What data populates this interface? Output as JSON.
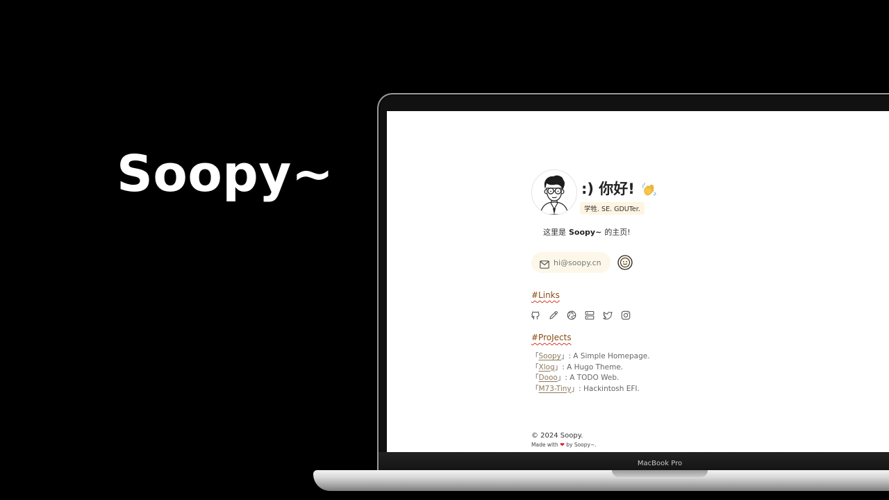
{
  "hero": {
    "title": "Soopy~"
  },
  "device": {
    "model_label": "MacBook Pro"
  },
  "profile": {
    "greeting": ":) 你好!",
    "wave_icon": "waving-hand-emoji",
    "tagline": "学牲. SE. GDUTer.",
    "intro_prefix": "这里是",
    "intro_name": "Soopy~",
    "intro_suffix": "的主页!"
  },
  "contact": {
    "email": "hi@soopy.cn",
    "mail_icon": "mail-icon",
    "extra_icon": "smile-face-icon"
  },
  "links": {
    "title": "#Links",
    "icons": [
      "github-icon",
      "pencil-icon",
      "aperture-icon",
      "server-icon",
      "twitter-icon",
      "instagram-icon"
    ]
  },
  "projects": {
    "title": "#ProJects",
    "items": [
      {
        "open": "「",
        "name": "Soopy",
        "close": "」",
        "desc": ": A Simple Homepage."
      },
      {
        "open": "「",
        "name": "Xlog",
        "close": "」",
        "desc": ": A Hugo Theme."
      },
      {
        "open": "「",
        "name": "Dooo",
        "close": "」",
        "desc": ": A TODO Web."
      },
      {
        "open": "「",
        "name": "M73-Tiny",
        "close": "」",
        "desc": ": Hackintosh EFI."
      }
    ]
  },
  "footer": {
    "copyright": "© 2024 Soopy.",
    "made_prefix": "Made with",
    "heart": "❤",
    "made_suffix": "by Soopy~."
  },
  "colors": {
    "background": "#000000",
    "accent_section": "#8a4b13",
    "pill_bg": "#fcf7e8",
    "heart": "#d9262c"
  }
}
